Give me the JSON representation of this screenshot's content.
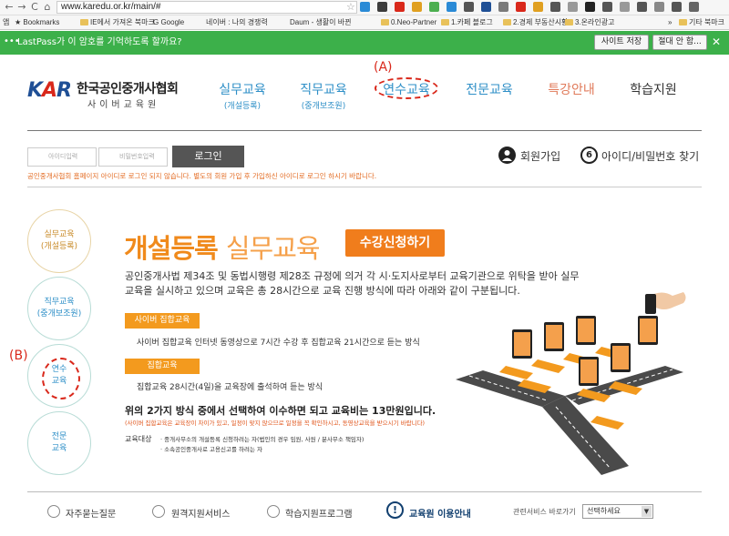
{
  "browser": {
    "url": "www.karedu.or.kr/main/#",
    "nav": [
      "←",
      "→",
      "C",
      "⌂"
    ],
    "bookmarks": [
      {
        "label": "앱",
        "folder": false
      },
      {
        "label": "★ Bookmarks",
        "folder": false
      },
      {
        "label": "IE에서 가져온 북마크",
        "folder": true
      },
      {
        "label": "G Google",
        "folder": false
      },
      {
        "label": "네이버 : 나의 경쟁력",
        "folder": false
      },
      {
        "label": "Daum - 생활이 바뀐",
        "folder": false
      },
      {
        "label": "0.Neo-Partner",
        "folder": true
      },
      {
        "label": "1.카페 블로그",
        "folder": true
      },
      {
        "label": "2.경제 부동산시황",
        "folder": true
      },
      {
        "label": "3.온라인광고",
        "folder": true
      },
      {
        "label": "»",
        "folder": false
      },
      {
        "label": "기타 북마크",
        "folder": true
      }
    ]
  },
  "lastpass": {
    "message": "LastPass가 이 암호를 기억하도록 할까요?",
    "save_label": "사이트 저장",
    "never_label": "절대 안 함...",
    "close": "✕"
  },
  "header": {
    "logo_mark": "KAR",
    "logo_title": "한국공인중개사협회",
    "logo_sub": "사이버교육원",
    "nav": [
      {
        "label": "실무교육",
        "sub": "(개설등록)",
        "color": "#2e8fc7"
      },
      {
        "label": "직무교육",
        "sub": "(중개보조원)",
        "color": "#2e8fc7"
      },
      {
        "label": "연수교육",
        "sub": "",
        "color": "#2e8fc7"
      },
      {
        "label": "전문교육",
        "sub": "",
        "color": "#2e8fc7"
      },
      {
        "label": "특강안내",
        "sub": "",
        "color": "#e07a5a"
      },
      {
        "label": "학습지원",
        "sub": "",
        "color": "#333333"
      }
    ],
    "annotation_a": "(A)"
  },
  "login": {
    "id_placeholder": "아이디입력",
    "pw_placeholder": "비밀번호입력",
    "button": "로그인",
    "join": "회원가입",
    "find": "아이디/비밀번호 찾기",
    "notice": "공인중개사협회 홈페이지 아이디로 로그인 되지 않습니다. 별도의 회원 가입 후 가입하신 아이디로 로그인 하시기 바랍니다."
  },
  "side_menu": [
    {
      "label": "실무교육\n(개설등록)",
      "color": "#c98b2a"
    },
    {
      "label": "직무교육\n(중개보조원)",
      "color": "#2e8fc7"
    },
    {
      "label": "연수\n교육",
      "color": "#2e8fc7"
    },
    {
      "label": "전문\n교육",
      "color": "#2e8fc7"
    }
  ],
  "annotation_b": "(B)",
  "main": {
    "title_1": "개설등록",
    "title_2": "실무교육",
    "apply": "수강신청하기",
    "intro": "공인중개사법 제34조 및 동법시행령 제28조 규정에 의거 각 시·도지사로부터 교육기관으로 위탁을 받아 실무교육을 실시하고 있으며 교육은 총 28시간으로 교육 진행 방식에 따라 아래와 같이 구분됩니다.",
    "methods": [
      {
        "tag": "사이버 집합교육",
        "desc": "사이버 집합교육 인터넷 동영상으로 7시간 수강 후 집합교육 21시간으로 듣는 방식"
      },
      {
        "tag": "집합교육",
        "desc": "집합교육 28시간(4일)을 교육장에 출석하여 듣는 방식"
      }
    ],
    "fee_line": "위의 2가지 방식 중에서 선택하여 이수하면 되고 교육비는 13만원입니다.",
    "fee_note": "(사이버 집합교육은 교육장이 차이가 있고, 일정이 맞지 않으므로 일정을 꼭 확인하시고, 동영상교육을 받으시기 바랍니다)",
    "target_label": "교육대상",
    "targets": [
      "· 중개사무소의 개설등록 신청하려는 자(법인의 경우 임원, 사원 / 분사무소 책임자)",
      "· 소속공인중개사로 고용신고를 하려는 자"
    ]
  },
  "footer": {
    "items": [
      "자주묻는질문",
      "원격지원서비스",
      "학습지원프로그램"
    ],
    "guide": "교육원 이용안내",
    "guide_icon": "!",
    "related_label": "관련서비스 바로가기",
    "related_select": "선택하세요"
  },
  "colors": {
    "accent_orange": "#f07d1c",
    "brand_blue": "#2e8fc7",
    "lastpass_green": "#3cb04a",
    "annotation_red": "#d9281b"
  }
}
